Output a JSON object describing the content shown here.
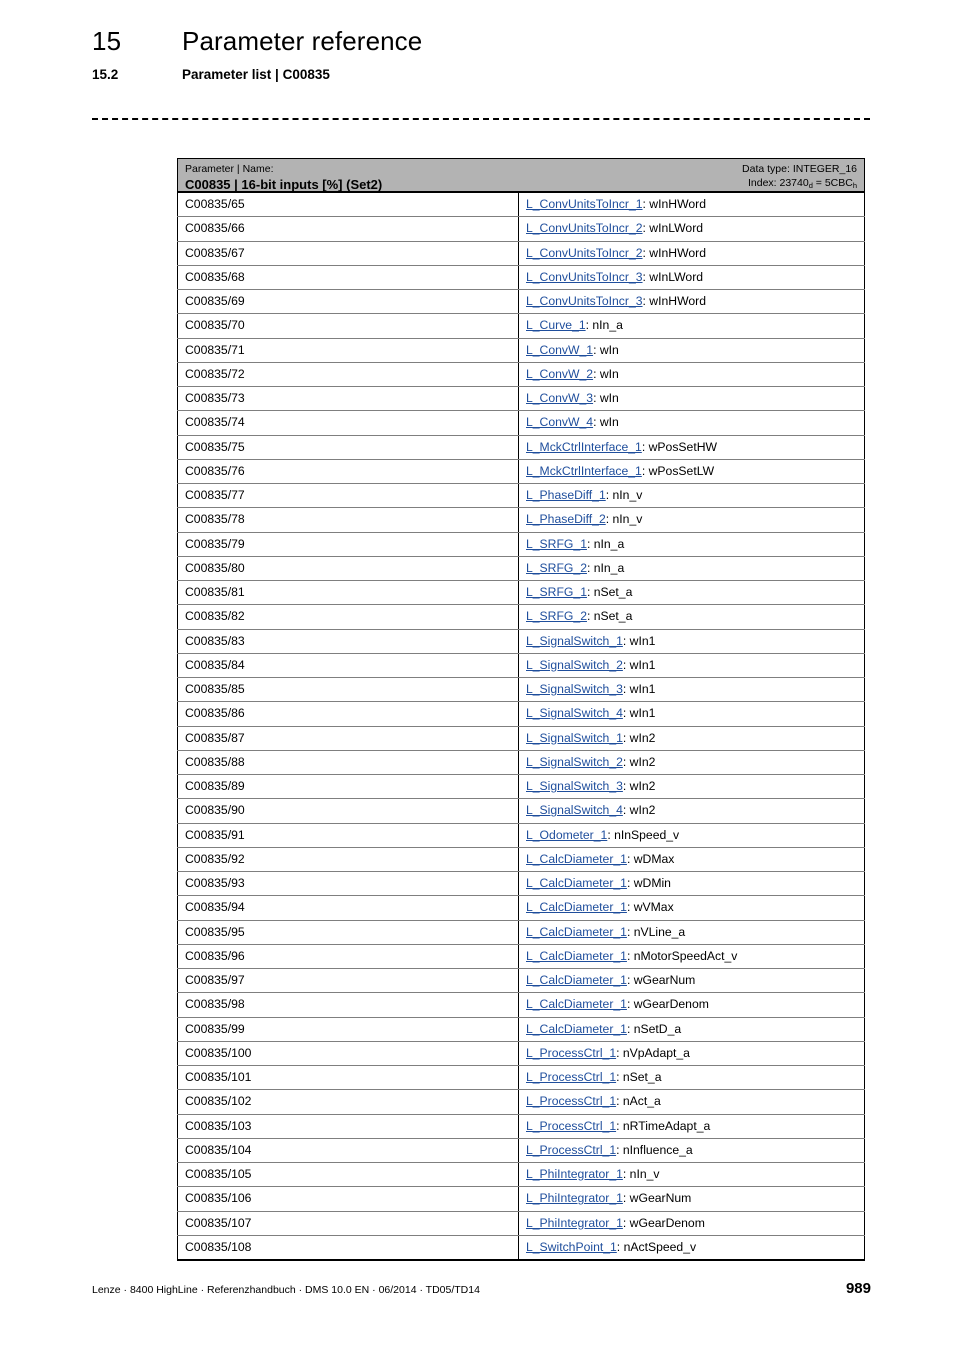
{
  "header": {
    "chapter_number": "15",
    "chapter_title": "Parameter reference",
    "section_number": "15.2",
    "section_title": "Parameter list | C00835"
  },
  "table_header": {
    "column_caption": "Parameter | Name:",
    "parameter_title": "C00835 | 16-bit inputs [%] (Set2)",
    "data_type_label": "Data type: INTEGER_16",
    "index_prefix": "Index: 23740",
    "index_sub_dec": "d",
    "index_middle": " = 5CBC",
    "index_sub_hex": "h"
  },
  "rows": [
    {
      "code": "C00835/65",
      "link": "L_ConvUnitsToIncr_1",
      "rest": ": wInHWord"
    },
    {
      "code": "C00835/66",
      "link": "L_ConvUnitsToIncr_2",
      "rest": ": wInLWord"
    },
    {
      "code": "C00835/67",
      "link": "L_ConvUnitsToIncr_2",
      "rest": ": wInHWord"
    },
    {
      "code": "C00835/68",
      "link": "L_ConvUnitsToIncr_3",
      "rest": ": wInLWord"
    },
    {
      "code": "C00835/69",
      "link": "L_ConvUnitsToIncr_3",
      "rest": ": wInHWord"
    },
    {
      "code": "C00835/70",
      "link": "L_Curve_1",
      "rest": ": nIn_a"
    },
    {
      "code": "C00835/71",
      "link": "L_ConvW_1",
      "rest": ": wIn"
    },
    {
      "code": "C00835/72",
      "link": "L_ConvW_2",
      "rest": ": wIn"
    },
    {
      "code": "C00835/73",
      "link": "L_ConvW_3",
      "rest": ": wIn"
    },
    {
      "code": "C00835/74",
      "link": "L_ConvW_4",
      "rest": ": wIn"
    },
    {
      "code": "C00835/75",
      "link": "L_MckCtrlInterface_1",
      "rest": ": wPosSetHW"
    },
    {
      "code": "C00835/76",
      "link": "L_MckCtrlInterface_1",
      "rest": ": wPosSetLW"
    },
    {
      "code": "C00835/77",
      "link": "L_PhaseDiff_1",
      "rest": ": nIn_v"
    },
    {
      "code": "C00835/78",
      "link": "L_PhaseDiff_2",
      "rest": ": nIn_v"
    },
    {
      "code": "C00835/79",
      "link": "L_SRFG_1",
      "rest": ": nIn_a"
    },
    {
      "code": "C00835/80",
      "link": "L_SRFG_2",
      "rest": ": nIn_a"
    },
    {
      "code": "C00835/81",
      "link": "L_SRFG_1",
      "rest": ": nSet_a"
    },
    {
      "code": "C00835/82",
      "link": "L_SRFG_2",
      "rest": ": nSet_a"
    },
    {
      "code": "C00835/83",
      "link": "L_SignalSwitch_1",
      "rest": ": wIn1"
    },
    {
      "code": "C00835/84",
      "link": "L_SignalSwitch_2",
      "rest": ": wIn1"
    },
    {
      "code": "C00835/85",
      "link": "L_SignalSwitch_3",
      "rest": ": wIn1"
    },
    {
      "code": "C00835/86",
      "link": "L_SignalSwitch_4",
      "rest": ": wIn1"
    },
    {
      "code": "C00835/87",
      "link": "L_SignalSwitch_1",
      "rest": ": wIn2"
    },
    {
      "code": "C00835/88",
      "link": "L_SignalSwitch_2",
      "rest": ": wIn2"
    },
    {
      "code": "C00835/89",
      "link": "L_SignalSwitch_3",
      "rest": ": wIn2"
    },
    {
      "code": "C00835/90",
      "link": "L_SignalSwitch_4",
      "rest": ": wIn2"
    },
    {
      "code": "C00835/91",
      "link": "L_Odometer_1",
      "rest": ": nInSpeed_v"
    },
    {
      "code": "C00835/92",
      "link": "L_CalcDiameter_1",
      "rest": ": wDMax"
    },
    {
      "code": "C00835/93",
      "link": "L_CalcDiameter_1",
      "rest": ": wDMin"
    },
    {
      "code": "C00835/94",
      "link": "L_CalcDiameter_1",
      "rest": ": wVMax"
    },
    {
      "code": "C00835/95",
      "link": "L_CalcDiameter_1",
      "rest": ": nVLine_a"
    },
    {
      "code": "C00835/96",
      "link": "L_CalcDiameter_1",
      "rest": ": nMotorSpeedAct_v"
    },
    {
      "code": "C00835/97",
      "link": "L_CalcDiameter_1",
      "rest": ": wGearNum"
    },
    {
      "code": "C00835/98",
      "link": "L_CalcDiameter_1",
      "rest": ": wGearDenom"
    },
    {
      "code": "C00835/99",
      "link": "L_CalcDiameter_1",
      "rest": ": nSetD_a"
    },
    {
      "code": "C00835/100",
      "link": "L_ProcessCtrl_1",
      "rest": ": nVpAdapt_a"
    },
    {
      "code": "C00835/101",
      "link": "L_ProcessCtrl_1",
      "rest": ": nSet_a"
    },
    {
      "code": "C00835/102",
      "link": "L_ProcessCtrl_1",
      "rest": ": nAct_a"
    },
    {
      "code": "C00835/103",
      "link": "L_ProcessCtrl_1",
      "rest": ": nRTimeAdapt_a"
    },
    {
      "code": "C00835/104",
      "link": "L_ProcessCtrl_1",
      "rest": ": nInfluence_a"
    },
    {
      "code": "C00835/105",
      "link": "L_PhiIntegrator_1",
      "rest": ": nIn_v"
    },
    {
      "code": "C00835/106",
      "link": "L_PhiIntegrator_1",
      "rest": ": wGearNum"
    },
    {
      "code": "C00835/107",
      "link": "L_PhiIntegrator_1",
      "rest": ": wGearDenom"
    },
    {
      "code": "C00835/108",
      "link": "L_SwitchPoint_1",
      "rest": ": nActSpeed_v"
    }
  ],
  "footer": {
    "text": "Lenze · 8400 HighLine · Referenzhandbuch · DMS 10.0 EN · 06/2014 · TD05/TD14",
    "page_number": "989"
  },
  "colors": {
    "link": "#1f4e9c",
    "header_background": "#b3b3b3",
    "border": "#000000"
  }
}
